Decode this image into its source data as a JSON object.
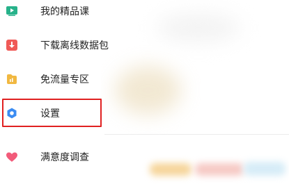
{
  "menu": {
    "items": [
      {
        "label": "我的精品课",
        "icon": "play-video-icon"
      },
      {
        "label": "下载离线数据包",
        "icon": "download-icon"
      },
      {
        "label": "免流量专区",
        "icon": "folder-chart-icon"
      },
      {
        "label": "设置",
        "icon": "settings-gear-icon",
        "selected": true
      },
      {
        "label": "满意度调查",
        "icon": "heart-icon"
      }
    ]
  },
  "colors": {
    "video_icon": "#27b28a",
    "download_icon": "#f05a57",
    "folder_icon": "#f1b841",
    "settings_icon": "#3b8cf2",
    "heart_icon": "#f25b7a",
    "selection_outline": "#e02020"
  }
}
